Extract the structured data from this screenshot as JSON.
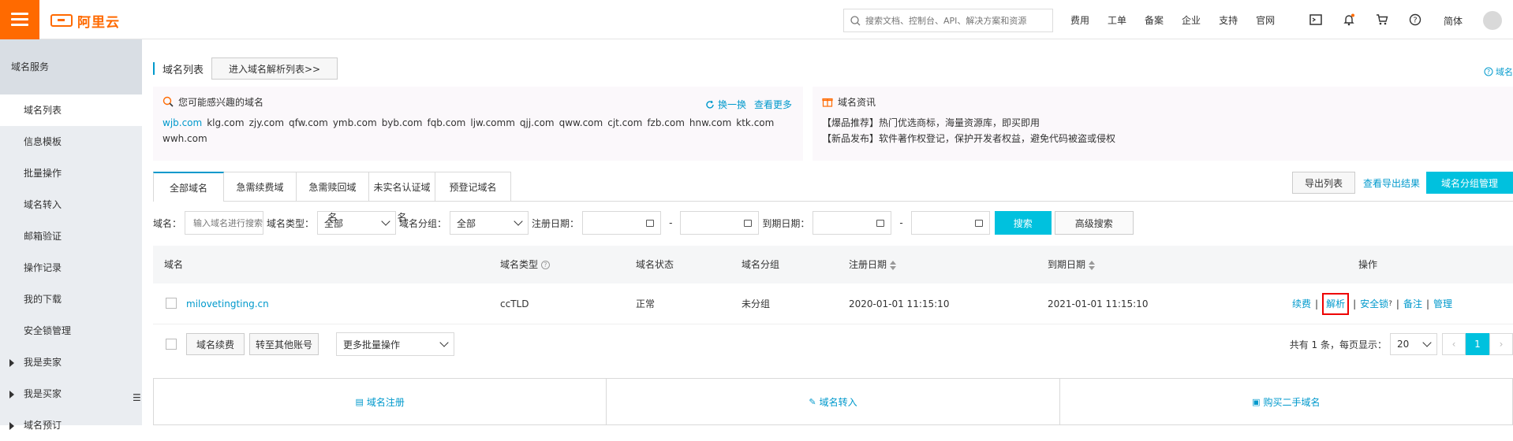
{
  "brand": {
    "name": "阿里云",
    "color": "#ff6a00"
  },
  "topbar": {
    "search_placeholder": "搜索文档、控制台、API、解决方案和资源",
    "nav": [
      "费用",
      "工单",
      "备案",
      "企业",
      "支持",
      "官网"
    ],
    "lang": "简体",
    "icons": [
      "terminal-icon",
      "bell-icon",
      "cart-icon",
      "help-icon"
    ]
  },
  "sidebar": {
    "header": "域名服务",
    "items": [
      {
        "label": "域名列表",
        "active": true
      },
      {
        "label": "信息模板"
      },
      {
        "label": "批量操作"
      },
      {
        "label": "域名转入"
      },
      {
        "label": "邮箱验证"
      },
      {
        "label": "操作记录"
      },
      {
        "label": "我的下载"
      },
      {
        "label": "安全锁管理"
      }
    ],
    "groups": [
      "我是卖家",
      "我是买家",
      "域名预订"
    ]
  },
  "main": {
    "title": "域名列表",
    "enter_dns_button": "进入域名解析列表>>",
    "help_link": "域名",
    "interest_panel": {
      "title": "您可能感兴趣的域名",
      "refresh": "换一换",
      "more": "查看更多",
      "domains": [
        "wjb.com",
        "klg.com",
        "zjy.com",
        "qfw.com",
        "ymb.com",
        "byb.com",
        "fqb.com",
        "ljw.comm",
        "qjj.com",
        "qww.com",
        "cjt.com",
        "fzb.com",
        "hnw.com",
        "ktk.com",
        "wwh.com"
      ]
    },
    "news_panel": {
      "title": "域名资讯",
      "lines": [
        "【爆品推荐】热门优选商标，海量资源库，即买即用",
        "【新品发布】软件著作权登记，保护开发者权益，避免代码被盗或侵权"
      ]
    },
    "tabs": [
      "全部域名",
      "急需续费域名",
      "急需赎回域名",
      "未实名认证域名",
      "预登记域名"
    ],
    "export_button": "导出列表",
    "view_export": "查看导出结果",
    "group_manage_button": "域名分组管理",
    "filters": {
      "domain_label": "域名：",
      "domain_placeholder": "输入域名进行搜索",
      "type_label": "域名类型：",
      "type_value": "全部",
      "group_label": "域名分组：",
      "group_value": "全部",
      "reg_date_label": "注册日期：",
      "exp_date_label": "到期日期：",
      "dash": "-",
      "search_button": "搜索",
      "advanced_button": "高级搜索"
    },
    "table": {
      "headers": [
        "域名",
        "域名类型",
        "域名状态",
        "域名分组",
        "注册日期",
        "到期日期",
        "操作"
      ],
      "rows": [
        {
          "domain": "milovetingting.cn",
          "type": "ccTLD",
          "status": "正常",
          "group": "未分组",
          "reg_date": "2020-01-01 11:15:10",
          "exp_date": "2021-01-01 11:15:10",
          "ops": [
            "续费",
            "解析",
            "安全锁",
            "备注",
            "管理"
          ]
        }
      ]
    },
    "bulk": {
      "renew_button": "域名续费",
      "transfer_button": "转至其他账号",
      "more_select": "更多批量操作",
      "total_text": "共有 1 条，每页显示：",
      "page_size": "20",
      "current_page": "1"
    },
    "bottom_links": [
      "域名注册",
      "域名转入",
      "购买二手域名"
    ]
  }
}
